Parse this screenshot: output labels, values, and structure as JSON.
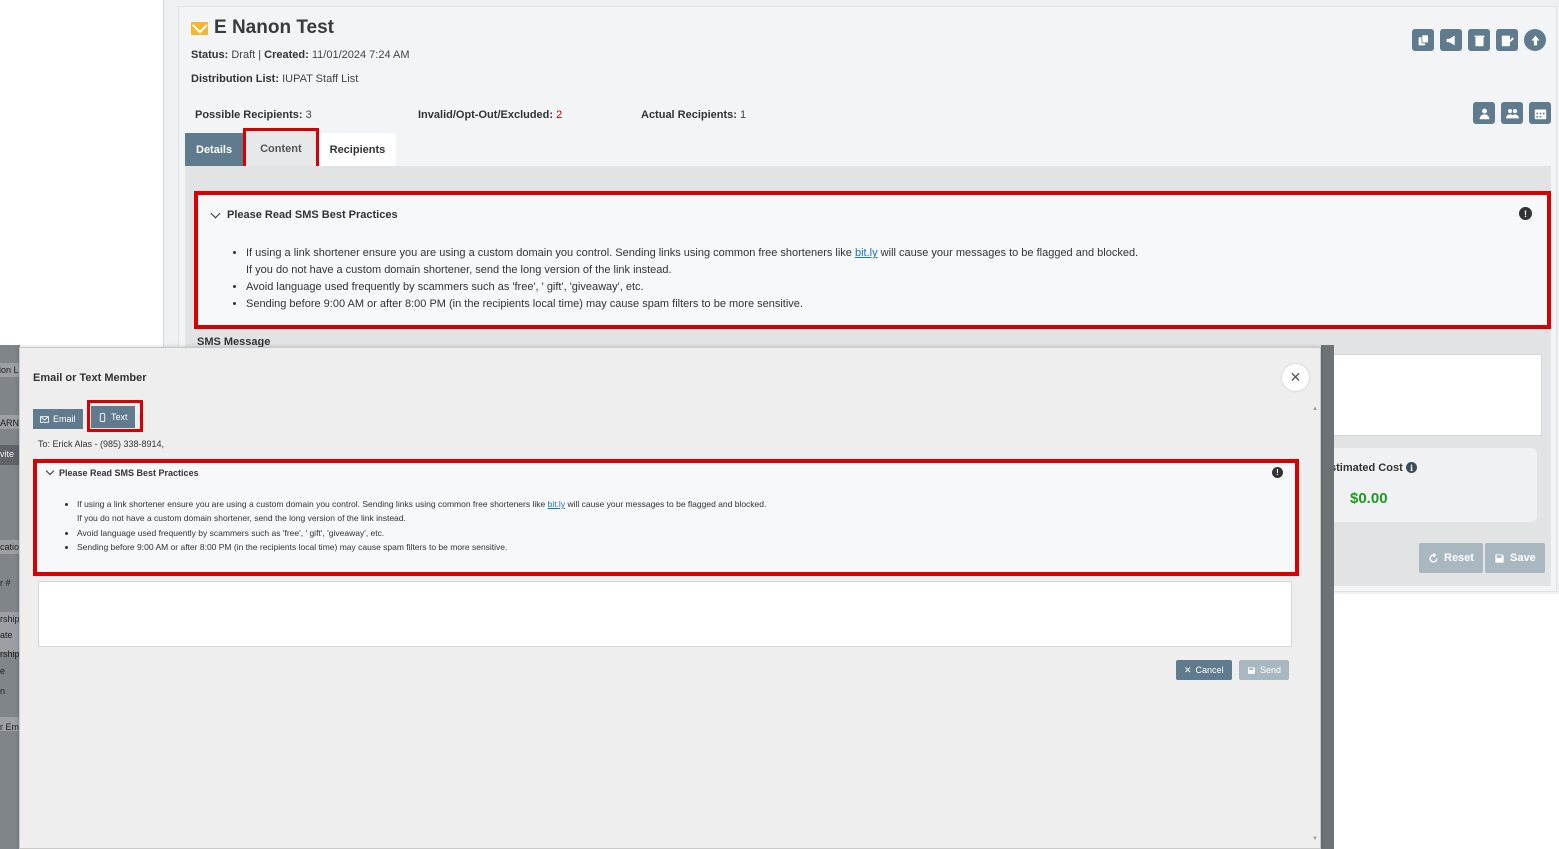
{
  "campaign": {
    "title": "E Nanon Test",
    "status_label": "Status:",
    "status_value": "Draft",
    "sep": "|",
    "created_label": "Created:",
    "created_value": "11/01/2024 7:24 AM",
    "dist_label": "Distribution List:",
    "dist_value": "IUPAT Staff List",
    "possible_label": "Possible Recipients:",
    "possible_value": "3",
    "invalid_label": "Invalid/Opt-Out/Excluded:",
    "invalid_value": "2",
    "actual_label": "Actual Recipients:",
    "actual_value": "1"
  },
  "tabs": {
    "details": "Details",
    "content": "Content",
    "recipients": "Recipients"
  },
  "best_practices": {
    "heading": "Please Read SMS Best Practices",
    "b1_pre": "If using a link shortener ensure you are using a custom domain you control. Sending links using common free shorteners like ",
    "b1_link": "bit.ly",
    "b1_post": " will cause your messages to be flagged and blocked.",
    "b1_line2": "If you do not have a custom domain shortener, send the long version of the link instead.",
    "b2": "Avoid language used frequently by scammers such as 'free', ' gift', 'giveaway', etc.",
    "b3": "Sending before 9:00 AM or after 8:00 PM (in the recipients local time) may cause spam filters to be more sensitive."
  },
  "sms_message_label": "SMS Message",
  "cost": {
    "label": "stimated Cost",
    "value": "$0.00"
  },
  "buttons": {
    "reset": "Reset",
    "save": "Save",
    "cancel": "Cancel",
    "send": "Send"
  },
  "modal": {
    "title": "Email or Text Member",
    "email_tab": "Email",
    "text_tab": "Text",
    "to": "To: Erick Alas - (985) 338-8914,"
  },
  "left_strip": [
    "ion L",
    "ARN",
    "vite",
    "catio",
    "r #",
    "rship",
    "ate",
    "rship",
    "e",
    "n",
    "r Emp"
  ],
  "colors": {
    "accent": "#5f7b8d",
    "highlight": "#d80000",
    "invalid": "#c00000",
    "cost": "#1f9a1f",
    "link": "#1f6fc4"
  },
  "icons": [
    "copy-icon",
    "megaphone-icon",
    "trash-icon",
    "edit-icon",
    "upload-icon",
    "user-icon",
    "users-icon",
    "calendar-icon",
    "envelope-icon",
    "refresh-icon",
    "floppy-icon",
    "close-icon",
    "phone-icon",
    "chevron-down-icon",
    "exclamation-icon",
    "info-icon"
  ]
}
